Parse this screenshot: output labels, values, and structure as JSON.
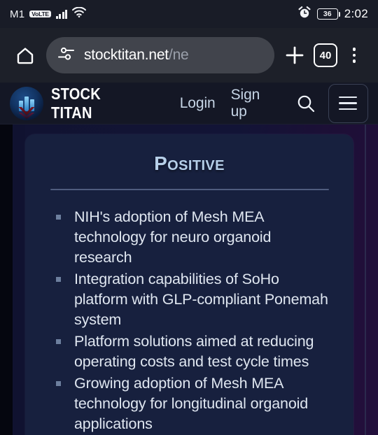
{
  "status_bar": {
    "carrier": "M1",
    "volte_badge": "VoLTE",
    "signal_icon": "signal-bars-icon",
    "wifi_icon": "wifi-icon",
    "alarm_icon": "alarm-clock-icon",
    "battery_level": "36",
    "time": "2:02"
  },
  "browser": {
    "home_icon": "home-icon",
    "url_permission_icon": "tune-sliders-icon",
    "url_domain": "stocktitan.net",
    "url_path": "/ne",
    "url_full": "stocktitan.net/ne",
    "new_tab_icon": "plus-icon",
    "tab_count": "40",
    "overflow_icon": "three-dot-menu-icon"
  },
  "site_nav": {
    "logo_icon": "stock-titan-logo-icon",
    "brand": "STOCK TITAN",
    "login_label": "Login",
    "signup_label": "Sign up",
    "search_icon": "search-icon",
    "menu_icon": "hamburger-menu-icon"
  },
  "card": {
    "title": "Positive",
    "bullets": [
      "NIH's adoption of Mesh MEA technology for neuro organoid research",
      "Integration capabilities of SoHo platform with GLP-compliant Ponemah system",
      "Platform solutions aimed at reducing operating costs and test cycle times",
      "Growing adoption of Mesh MEA technology for longitudinal organoid applications"
    ]
  },
  "colors": {
    "status_bar_bg": "#191c27",
    "browser_chrome_bg": "#1d2029",
    "url_bar_bg": "#41444c",
    "site_nav_bg": "#141725",
    "card_bg": "#17203e",
    "card_title": "#b6cfe9",
    "body_text": "#dfe6f0",
    "bullet_marker": "#6d7f9e",
    "divider": "#4f5c7e",
    "nav_link": "#c6d5e6"
  }
}
